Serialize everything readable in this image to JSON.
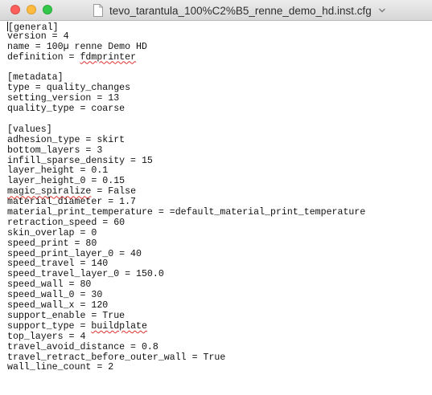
{
  "window": {
    "title": "tevo_tarantula_100%C2%B5_renne_demo_hd.inst.cfg",
    "icons": {
      "close": "close-circle-icon",
      "minimize": "minimize-circle-icon",
      "zoom": "zoom-circle-icon",
      "document": "document-icon",
      "title_menu": "chevron-down-icon"
    },
    "colors": {
      "close": "#fc605c",
      "minimize": "#fdbc40",
      "zoom": "#34c84a",
      "spellcheck": "#e0322d"
    }
  },
  "editor": {
    "lines": [
      {
        "text": "[general]"
      },
      {
        "text": "version = 4"
      },
      {
        "text": "name = 100µ renne Demo HD"
      },
      {
        "pre": "definition = ",
        "mark": "fdmprinter",
        "post": ""
      },
      {
        "text": ""
      },
      {
        "text": "[metadata]"
      },
      {
        "text": "type = quality_changes"
      },
      {
        "text": "setting_version = 13"
      },
      {
        "text": "quality_type = coarse"
      },
      {
        "text": ""
      },
      {
        "text": "[values]"
      },
      {
        "text": "adhesion_type = skirt"
      },
      {
        "text": "bottom_layers = 3"
      },
      {
        "text": "infill_sparse_density = 15"
      },
      {
        "text": "layer_height = 0.1"
      },
      {
        "text": "layer_height_0 = 0.15"
      },
      {
        "pre": "",
        "mark": "magic_spiralize",
        "post": " = False"
      },
      {
        "text": "material_diameter = 1.7"
      },
      {
        "text": "material_print_temperature = =default_material_print_temperature"
      },
      {
        "text": "retraction_speed = 60"
      },
      {
        "text": "skin_overlap = 0"
      },
      {
        "text": "speed_print = 80"
      },
      {
        "text": "speed_print_layer_0 = 40"
      },
      {
        "text": "speed_travel = 140"
      },
      {
        "text": "speed_travel_layer_0 = 150.0"
      },
      {
        "text": "speed_wall = 80"
      },
      {
        "text": "speed_wall_0 = 30"
      },
      {
        "text": "speed_wall_x = 120"
      },
      {
        "text": "support_enable = True"
      },
      {
        "pre": "support_type = ",
        "mark": "buildplate",
        "post": ""
      },
      {
        "text": "top_layers = 4"
      },
      {
        "text": "travel_avoid_distance = 0.8"
      },
      {
        "text": "travel_retract_before_outer_wall = True"
      },
      {
        "text": "wall_line_count = 2"
      }
    ]
  }
}
